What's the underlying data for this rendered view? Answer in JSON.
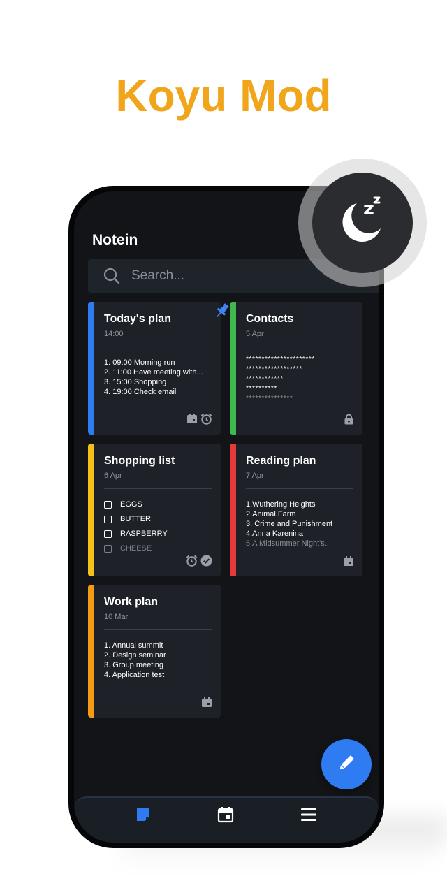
{
  "headline": "Koyu Mod",
  "app": {
    "title": "Notein",
    "search_placeholder": "Search..."
  },
  "notes": [
    {
      "title": "Today's plan",
      "date": "14:00",
      "color": "#2f7bf2",
      "pinned": true,
      "lines": [
        "1. 09:00  Morning run",
        "2. 11:00  Have meeting with...",
        "3. 15:00  Shopping",
        "4. 19:00  Check email"
      ],
      "icons": [
        "calendar-icon",
        "alarm-icon"
      ]
    },
    {
      "title": "Contacts",
      "date": "5 Apr",
      "color": "#3fba4f",
      "lines": [
        "**********************",
        "******************",
        "************",
        "**********",
        "***************"
      ],
      "icons": [
        "lock-icon"
      ]
    },
    {
      "title": "Shopping list",
      "date": "6 Apr",
      "color": "#f5c018",
      "checklist": [
        "EGGS",
        "BUTTER",
        "RASPBERRY",
        "CHEESE"
      ],
      "icons": [
        "alarm-icon",
        "check-circle-icon"
      ]
    },
    {
      "title": "Reading plan",
      "date": "7 Apr",
      "color": "#e53a3a",
      "lines": [
        "1.Wuthering Heights",
        "2.Animal Farm",
        "3. Crime and Punishment",
        "4.Anna Karenina",
        "5.A Midsummer Night's..."
      ],
      "icons": [
        "calendar-icon"
      ]
    },
    {
      "title": "Work plan",
      "date": "10 Mar",
      "color": "#f59a12",
      "lines": [
        "1. Annual summit",
        "2. Design seminar",
        "3. Group meeting",
        "4. Application test"
      ],
      "icons": [
        "calendar-icon"
      ]
    }
  ],
  "colors": {
    "accent": "#2f7bf2",
    "headline": "#f0a51b",
    "background": "#121418",
    "card": "#1e2128"
  }
}
